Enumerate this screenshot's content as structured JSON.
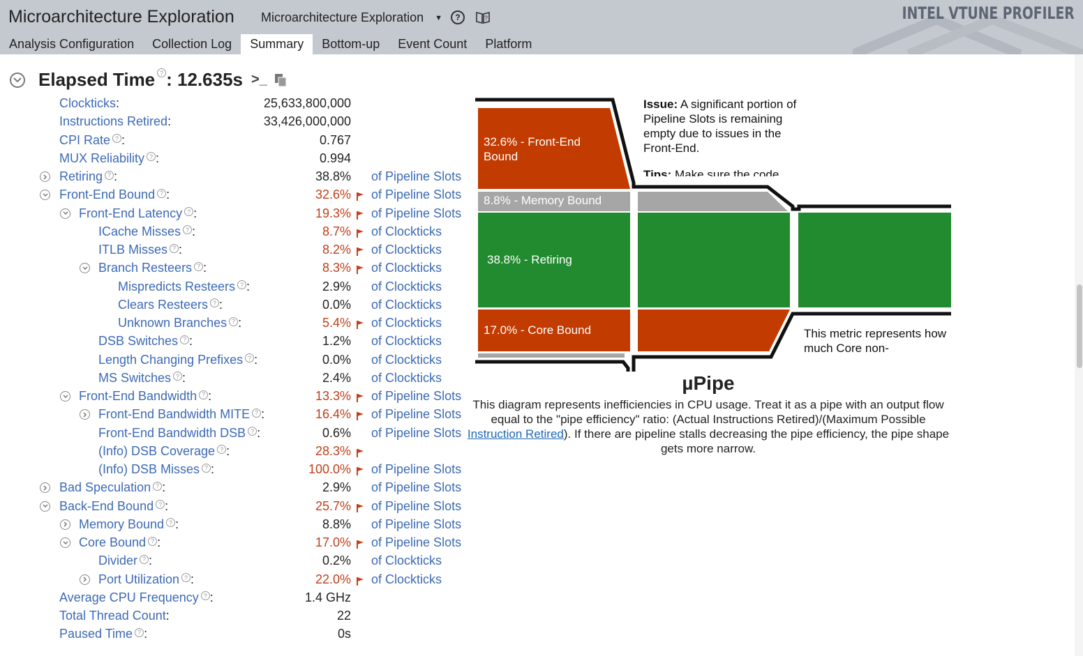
{
  "app": {
    "title": "Microarchitecture Exploration",
    "analysis_select": "Microarchitecture Exploration",
    "brand": "INTEL VTUNE PROFILER"
  },
  "tabs": [
    "Analysis Configuration",
    "Collection Log",
    "Summary",
    "Bottom-up",
    "Event Count",
    "Platform"
  ],
  "active_tab": "Summary",
  "summary": {
    "elapsed_label": "Elapsed Time",
    "elapsed_value": ": 12.635s",
    "rows": [
      {
        "label": "Clockticks",
        "help": false,
        "value": "25,633,800,000",
        "unit": "",
        "warn": false,
        "flag": false,
        "indent": 0,
        "toggle": "none"
      },
      {
        "label": "Instructions Retired",
        "help": false,
        "value": "33,426,000,000",
        "unit": "",
        "warn": false,
        "flag": false,
        "indent": 0,
        "toggle": "none"
      },
      {
        "label": "CPI Rate",
        "help": true,
        "value": "0.767",
        "unit": "",
        "warn": false,
        "flag": false,
        "indent": 0,
        "toggle": "none"
      },
      {
        "label": "MUX Reliability",
        "help": true,
        "value": "0.994",
        "unit": "",
        "warn": false,
        "flag": false,
        "indent": 0,
        "toggle": "none"
      },
      {
        "label": "Retiring",
        "help": true,
        "value": "38.8%",
        "unit": "of Pipeline Slots",
        "warn": false,
        "flag": false,
        "indent": 0,
        "toggle": "collapsed"
      },
      {
        "label": "Front-End Bound",
        "help": true,
        "value": "32.6%",
        "unit": "of Pipeline Slots",
        "warn": true,
        "flag": true,
        "indent": 0,
        "toggle": "expanded"
      },
      {
        "label": "Front-End Latency",
        "help": true,
        "value": "19.3%",
        "unit": "of Pipeline Slots",
        "warn": true,
        "flag": true,
        "indent": 1,
        "toggle": "expanded"
      },
      {
        "label": "ICache Misses",
        "help": true,
        "value": "8.7%",
        "unit": "of Clockticks",
        "warn": true,
        "flag": true,
        "indent": 2,
        "toggle": "none"
      },
      {
        "label": "ITLB Misses",
        "help": true,
        "value": "8.2%",
        "unit": "of Clockticks",
        "warn": true,
        "flag": true,
        "indent": 2,
        "toggle": "none"
      },
      {
        "label": "Branch Resteers",
        "help": true,
        "value": "8.3%",
        "unit": "of Clockticks",
        "warn": true,
        "flag": true,
        "indent": 2,
        "toggle": "expanded"
      },
      {
        "label": "Mispredicts Resteers",
        "help": true,
        "value": "2.9%",
        "unit": "of Clockticks",
        "warn": false,
        "flag": false,
        "indent": 3,
        "toggle": "none"
      },
      {
        "label": "Clears Resteers",
        "help": true,
        "value": "0.0%",
        "unit": "of Clockticks",
        "warn": false,
        "flag": false,
        "indent": 3,
        "toggle": "none"
      },
      {
        "label": "Unknown Branches",
        "help": true,
        "value": "5.4%",
        "unit": "of Clockticks",
        "warn": true,
        "flag": true,
        "indent": 3,
        "toggle": "none"
      },
      {
        "label": "DSB Switches",
        "help": true,
        "value": "1.2%",
        "unit": "of Clockticks",
        "warn": false,
        "flag": false,
        "indent": 2,
        "toggle": "none"
      },
      {
        "label": "Length Changing Prefixes",
        "help": true,
        "value": "0.0%",
        "unit": "of Clockticks",
        "warn": false,
        "flag": false,
        "indent": 2,
        "toggle": "none"
      },
      {
        "label": "MS Switches",
        "help": true,
        "value": "2.4%",
        "unit": "of Clockticks",
        "warn": false,
        "flag": false,
        "indent": 2,
        "toggle": "none"
      },
      {
        "label": "Front-End Bandwidth",
        "help": true,
        "value": "13.3%",
        "unit": "of Pipeline Slots",
        "warn": true,
        "flag": true,
        "indent": 1,
        "toggle": "expanded"
      },
      {
        "label": "Front-End Bandwidth MITE",
        "help": true,
        "value": "16.4%",
        "unit": "of Pipeline Slots",
        "warn": true,
        "flag": true,
        "indent": 2,
        "toggle": "collapsed"
      },
      {
        "label": "Front-End Bandwidth DSB",
        "help": true,
        "value": "0.6%",
        "unit": "of Pipeline Slots",
        "warn": false,
        "flag": false,
        "indent": 2,
        "toggle": "none"
      },
      {
        "label": "(Info) DSB Coverage",
        "help": true,
        "value": "28.3%",
        "unit": "",
        "warn": true,
        "flag": true,
        "indent": 2,
        "toggle": "none"
      },
      {
        "label": "(Info) DSB Misses",
        "help": true,
        "value": "100.0%",
        "unit": "of Pipeline Slots",
        "warn": true,
        "flag": true,
        "indent": 2,
        "toggle": "none"
      },
      {
        "label": "Bad Speculation",
        "help": true,
        "value": "2.9%",
        "unit": "of Pipeline Slots",
        "warn": false,
        "flag": false,
        "indent": 0,
        "toggle": "collapsed"
      },
      {
        "label": "Back-End Bound",
        "help": true,
        "value": "25.7%",
        "unit": "of Pipeline Slots",
        "warn": true,
        "flag": true,
        "indent": 0,
        "toggle": "expanded"
      },
      {
        "label": "Memory Bound",
        "help": true,
        "value": "8.8%",
        "unit": "of Pipeline Slots",
        "warn": false,
        "flag": false,
        "indent": 1,
        "toggle": "collapsed"
      },
      {
        "label": "Core Bound",
        "help": true,
        "value": "17.0%",
        "unit": "of Pipeline Slots",
        "warn": true,
        "flag": true,
        "indent": 1,
        "toggle": "expanded"
      },
      {
        "label": "Divider",
        "help": true,
        "value": "0.2%",
        "unit": "of Clockticks",
        "warn": false,
        "flag": false,
        "indent": 2,
        "toggle": "none"
      },
      {
        "label": "Port Utilization",
        "help": true,
        "value": "22.0%",
        "unit": "of Clockticks",
        "warn": true,
        "flag": true,
        "indent": 2,
        "toggle": "collapsed"
      },
      {
        "label": "Average CPU Frequency",
        "help": true,
        "value": "1.4 GHz",
        "unit": "",
        "warn": false,
        "flag": false,
        "indent": 0,
        "toggle": "none"
      },
      {
        "label": "Total Thread Count",
        "help": false,
        "value": "22",
        "unit": "",
        "warn": false,
        "flag": false,
        "indent": 0,
        "toggle": "none"
      },
      {
        "label": "Paused Time",
        "help": true,
        "value": "0s",
        "unit": "",
        "warn": false,
        "flag": false,
        "indent": 0,
        "toggle": "none"
      }
    ]
  },
  "upipe": {
    "segments": {
      "front_end": "32.6% - Front-End Bound",
      "memory": "8.8% - Memory Bound",
      "retiring": "38.8% - Retiring",
      "core": "17.0% - Core Bound"
    },
    "issue_label": "Issue:",
    "issue_text": " A significant portion of Pipeline Slots is remaining empty due to issues in the Front-End.",
    "tips_label": "Tips:",
    "tips_text": " Make sure the code",
    "metric_text": "This metric represents how much Core non-",
    "title": "µPipe",
    "desc_1": "This diagram represents inefficiencies in CPU usage. Treat it as a pipe with an output flow equal to the \"pipe efficiency\" ratio: (Actual Instructions Retired)/(Maximum Possible ",
    "desc_link": "Instruction Retired",
    "desc_2": "). If there are pipeline stalls decreasing the pipe efficiency, the pipe shape gets more narrow.",
    "colors": {
      "front_end": "#c23b00",
      "memory": "#a6a6a6",
      "retiring": "#228b30",
      "core": "#c23b00"
    }
  }
}
